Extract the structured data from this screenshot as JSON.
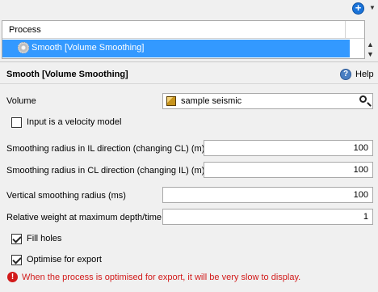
{
  "toolbar": {
    "add_symbol": "+",
    "dropdown_symbol": "▼"
  },
  "process_list": {
    "header": "Process",
    "items": [
      {
        "label": "Smooth [Volume Smoothing]",
        "selected": true
      }
    ],
    "scroll_up": "▲",
    "scroll_down": "▼"
  },
  "section": {
    "title": "Smooth [Volume Smoothing]",
    "help_symbol": "?",
    "help_label": "Help"
  },
  "form": {
    "volume_label": "Volume",
    "volume_value": "sample seismic",
    "velocity_label": "Input is a velocity model",
    "velocity_checked": false,
    "il_radius_label": "Smoothing radius in IL direction (changing CL) (m)",
    "il_radius_value": "100",
    "cl_radius_label": "Smoothing radius in CL direction (changing IL) (m)",
    "cl_radius_value": "100",
    "vertical_label": "Vertical smoothing radius (ms)",
    "vertical_value": "100",
    "weight_label": "Relative weight at maximum depth/time",
    "weight_value": "1",
    "fill_holes_label": "Fill holes",
    "fill_holes_checked": true,
    "optimise_label": "Optimise for export",
    "optimise_checked": true
  },
  "warning": {
    "symbol": "!",
    "text": "When the process is optimised for export, it will be very slow to display.",
    "color": "#d21a1a"
  },
  "colors": {
    "selection": "#3399ff",
    "background": "#f0f0f0"
  }
}
